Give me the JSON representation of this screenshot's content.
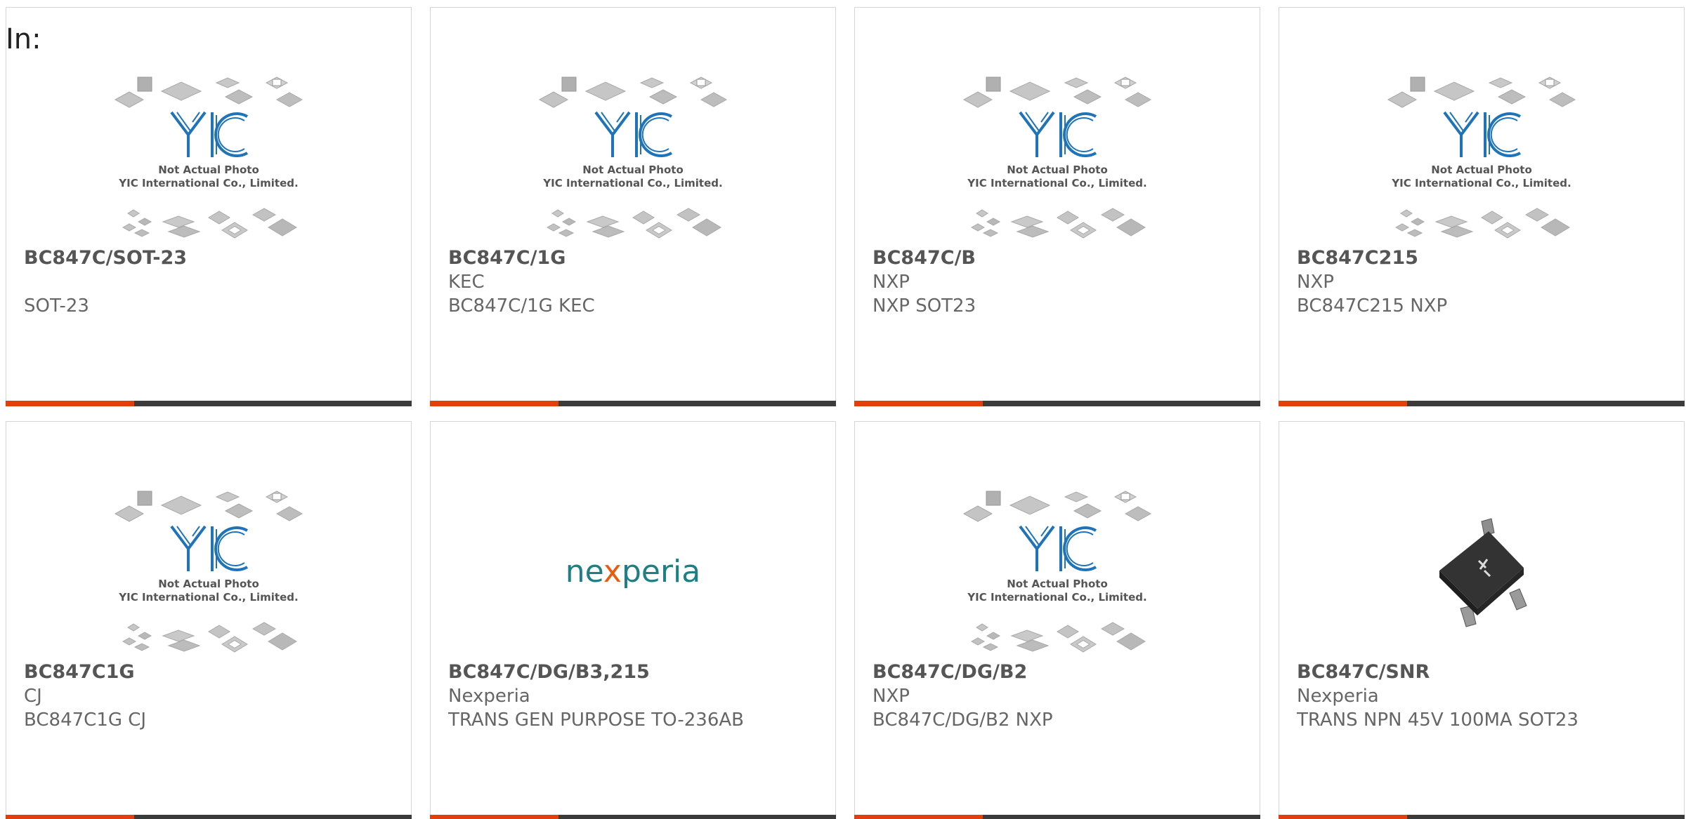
{
  "page": {
    "in_label": "In:"
  },
  "colors": {
    "accent": "#e2400b",
    "bar_dark": "#3b3b3b",
    "yic_blue": "#1f74b9",
    "nexperia_teal": "#1e7f86",
    "nexperia_orange": "#ea5b0c"
  },
  "placeholder": {
    "logo_text": "YIC",
    "line1": "Not Actual Photo",
    "line2": "YIC International Co., Limited."
  },
  "nexperia_logo": {
    "before": "ne",
    "x": "x",
    "after": "peria"
  },
  "products": [
    {
      "name": "BC847C/SOT-23",
      "maker": "",
      "desc": "SOT-23",
      "image": "yic-placeholder"
    },
    {
      "name": "BC847C/1G",
      "maker": "KEC",
      "desc": "BC847C/1G KEC",
      "image": "yic-placeholder"
    },
    {
      "name": "BC847C/B",
      "maker": "NXP",
      "desc": "NXP SOT23",
      "image": "yic-placeholder"
    },
    {
      "name": "BC847C215",
      "maker": "NXP",
      "desc": "BC847C215 NXP",
      "image": "yic-placeholder"
    },
    {
      "name": "BC847C1G",
      "maker": "CJ",
      "desc": "BC847C1G CJ",
      "image": "yic-placeholder"
    },
    {
      "name": "BC847C/DG/B3,215",
      "maker": "Nexperia",
      "desc": "TRANS GEN PURPOSE TO-236AB",
      "image": "nexperia-logo"
    },
    {
      "name": "BC847C/DG/B2",
      "maker": "NXP",
      "desc": "BC847C/DG/B2 NXP",
      "image": "yic-placeholder"
    },
    {
      "name": "BC847C/SNR",
      "maker": "Nexperia",
      "desc": "TRANS NPN 45V 100MA SOT23",
      "image": "sot23-chip-photo"
    }
  ]
}
